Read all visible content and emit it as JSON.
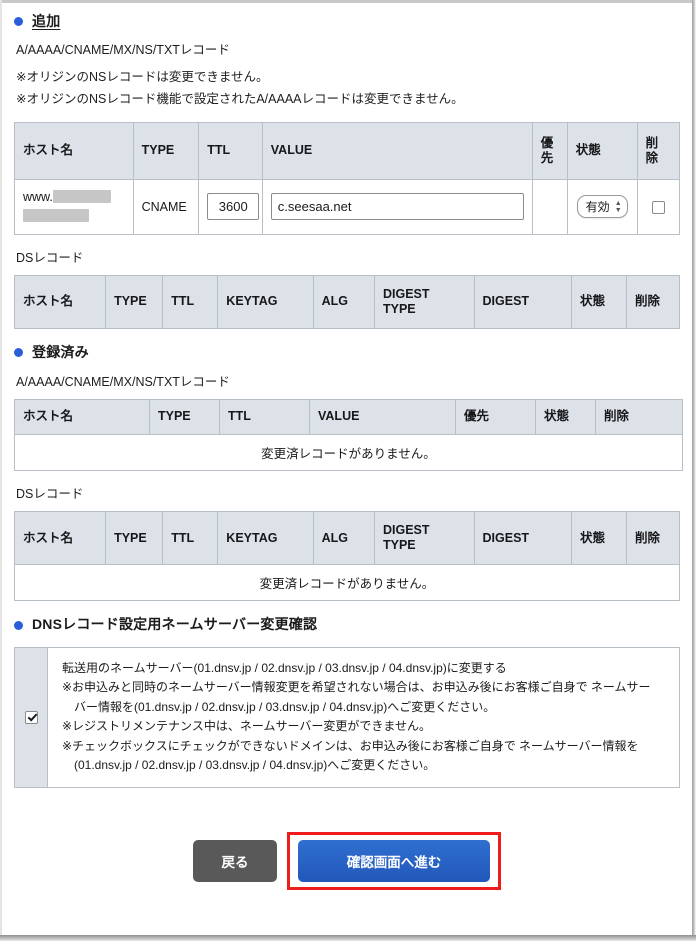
{
  "sections": {
    "add": {
      "heading": "追加",
      "record_label": "A/AAAA/CNAME/MX/NS/TXTレコード",
      "notes": [
        "※オリジンのNSレコードは変更できません。",
        "※オリジンのNSレコード機能で設定されたA/AAAAレコードは変更できません。"
      ],
      "ds_label": "DSレコード"
    },
    "registered": {
      "heading": "登録済み",
      "record_label": "A/AAAA/CNAME/MX/NS/TXTレコード",
      "ds_label": "DSレコード",
      "empty_message": "変更済レコードがありません。"
    },
    "nameserver": {
      "heading": "DNSレコード設定用ネームサーバー変更確認",
      "checkbox_checked": true,
      "lines": [
        "転送用のネームサーバー(01.dnsv.jp / 02.dnsv.jp / 03.dnsv.jp / 04.dnsv.jp)に変更する",
        "※お申込みと同時のネームサーバー情報変更を希望されない場合は、お申込み後にお客様ご自身で ネームサー",
        "バー情報を(01.dnsv.jp / 02.dnsv.jp / 03.dnsv.jp / 04.dnsv.jp)へご変更ください。",
        "※レジストリメンテナンス中は、ネームサーバー変更ができません。",
        "※チェックボックスにチェックができないドメインは、お申込み後にお客様ご自身で ネームサーバー情報を",
        "(01.dnsv.jp / 02.dnsv.jp / 03.dnsv.jp / 04.dnsv.jp)へご変更ください。"
      ]
    }
  },
  "tables": {
    "add_records": {
      "columns": [
        "ホスト名",
        "TYPE",
        "TTL",
        "VALUE",
        "優先",
        "状態",
        "削除"
      ],
      "priority_header_wrapped": [
        "優",
        "先"
      ],
      "delete_header_wrapped": [
        "削",
        "除"
      ],
      "rows": [
        {
          "host_prefix": "www.",
          "host_redacted": true,
          "type": "CNAME",
          "ttl": "3600",
          "value": "c.seesaa.net",
          "priority": "",
          "status": "有効",
          "delete_checked": false
        }
      ]
    },
    "add_ds": {
      "columns": [
        "ホスト名",
        "TYPE",
        "TTL",
        "KEYTAG",
        "ALG",
        "DIGEST TYPE",
        "DIGEST",
        "状態",
        "削除"
      ],
      "digest_type_wrapped": [
        "DIGEST",
        "TYPE"
      ],
      "rows": []
    },
    "registered_records": {
      "columns": [
        "ホスト名",
        "TYPE",
        "TTL",
        "VALUE",
        "優先",
        "状態",
        "削除"
      ],
      "rows": []
    },
    "registered_ds": {
      "columns": [
        "ホスト名",
        "TYPE",
        "TTL",
        "KEYTAG",
        "ALG",
        "DIGEST TYPE",
        "DIGEST",
        "状態",
        "削除"
      ],
      "digest_type_wrapped": [
        "DIGEST",
        "TYPE"
      ],
      "rows": []
    }
  },
  "status_options": [
    "有効"
  ],
  "footer": {
    "back_label": "戻る",
    "submit_label": "確認画面へ進む",
    "submit_highlighted": true
  },
  "colors": {
    "accent_bullet": "#2b5fd9",
    "table_header_bg": "#dde1e8",
    "table_border": "#b9bfc7",
    "primary_button": "#2558ba",
    "back_button": "#595959",
    "highlight_border": "#ee1c1c"
  }
}
